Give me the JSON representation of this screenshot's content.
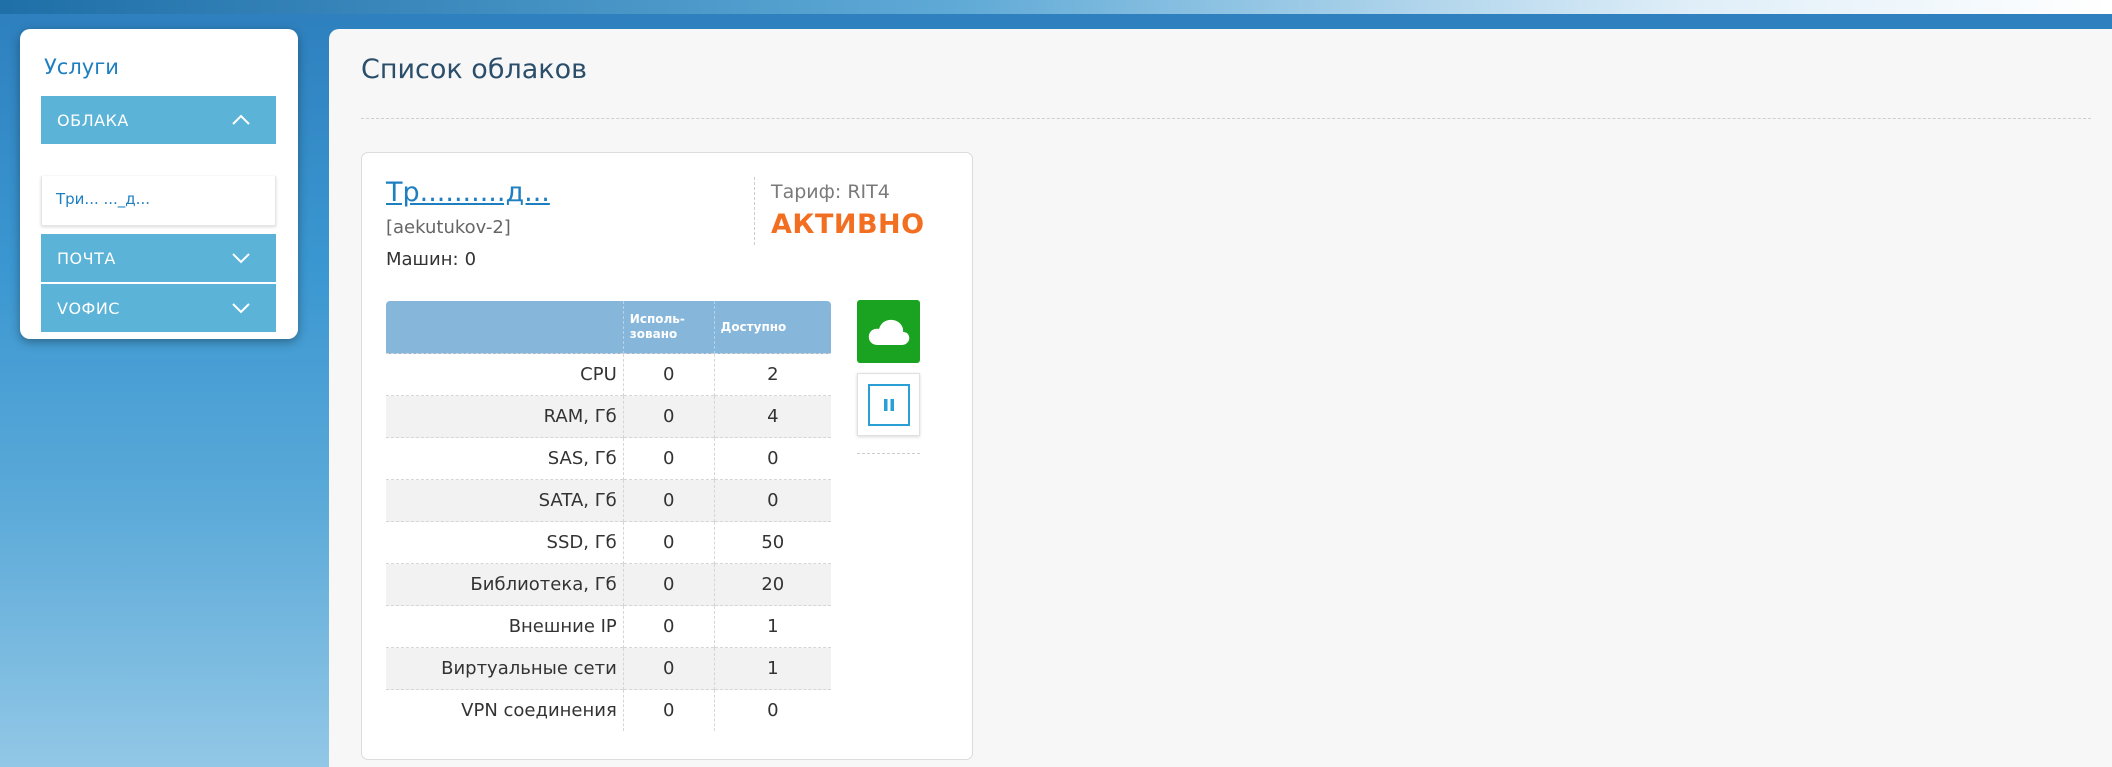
{
  "sidebar": {
    "title": "Услуги",
    "menus": [
      {
        "label": "ОБЛАКА",
        "expanded": true,
        "items": [
          {
            "label": "Три... ..._д..."
          }
        ]
      },
      {
        "label": "ПОЧТА",
        "expanded": false
      },
      {
        "label": "VОФИС",
        "expanded": false
      }
    ]
  },
  "main": {
    "title": "Список облаков",
    "cloud": {
      "name": "Тр..........д...",
      "id": "[aekutukov-2]",
      "machines_label": "Машин:",
      "machines_value": "0",
      "tariff_label": "Тариф:",
      "tariff_value": "RIT4",
      "status": "АКТИВНО",
      "table": {
        "headers": {
          "name": "",
          "used": "Исполь-\nзовано",
          "available": "Доступно"
        },
        "rows": [
          {
            "name": "CPU",
            "used": "0",
            "available": "2"
          },
          {
            "name": "RAM, Гб",
            "used": "0",
            "available": "4"
          },
          {
            "name": "SAS, Гб",
            "used": "0",
            "available": "0"
          },
          {
            "name": "SATA, Гб",
            "used": "0",
            "available": "0"
          },
          {
            "name": "SSD, Гб",
            "used": "0",
            "available": "50"
          },
          {
            "name": "Библиотека, Гб",
            "used": "0",
            "available": "20"
          },
          {
            "name": "Внешние IP",
            "used": "0",
            "available": "1"
          },
          {
            "name": "Виртуальные сети",
            "used": "0",
            "available": "1"
          },
          {
            "name": "VPN соединения",
            "used": "0",
            "available": "0"
          }
        ]
      }
    }
  },
  "colors": {
    "accent": "#1e7fc0",
    "menu": "#5bb3d7",
    "status": "#f26f21",
    "cloud_button": "#1aa321",
    "table_header": "#86b7db"
  },
  "icons": {
    "cloud_button": "cloud-icon",
    "pause_button": "pause-icon",
    "menu_expanded": "chevron-up-icon",
    "menu_collapsed": "chevron-down-icon"
  }
}
